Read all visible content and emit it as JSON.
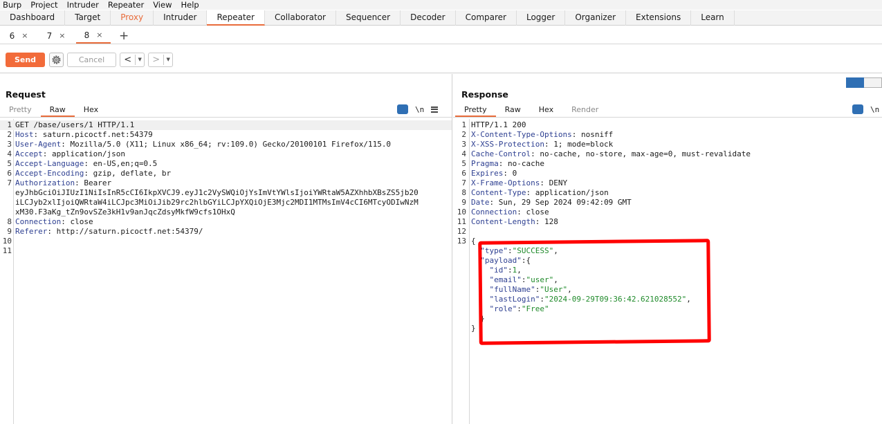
{
  "menubar": [
    "Burp",
    "Project",
    "Intruder",
    "Repeater",
    "View",
    "Help"
  ],
  "tool_tabs": [
    "Dashboard",
    "Target",
    "Proxy",
    "Intruder",
    "Repeater",
    "Collaborator",
    "Sequencer",
    "Decoder",
    "Comparer",
    "Logger",
    "Organizer",
    "Extensions",
    "Learn"
  ],
  "sub_tabs": [
    {
      "label": "6",
      "close": "×"
    },
    {
      "label": "7",
      "close": "×"
    },
    {
      "label": "8",
      "close": "×"
    }
  ],
  "sub_tab_add": "+",
  "toolbar": {
    "send": "Send",
    "cancel": "Cancel",
    "prev": "<",
    "next": ">",
    "dropdown": "▼"
  },
  "colors": {
    "accent": "#e86b3a",
    "send": "#f26b3a",
    "blue": "#2f6fb4",
    "annotation": "#ff0000"
  },
  "request": {
    "title": "Request",
    "view_tabs": [
      "Pretty",
      "Raw",
      "Hex"
    ],
    "newline_label": "\\n",
    "lines": [
      {
        "n": "1",
        "name": "",
        "value": "GET /base/users/1 HTTP/1.1"
      },
      {
        "n": "2",
        "name": "Host",
        "value": ": saturn.picoctf.net:54379"
      },
      {
        "n": "3",
        "name": "User-Agent",
        "value": ": Mozilla/5.0 (X11; Linux x86_64; rv:109.0) Gecko/20100101 Firefox/115.0"
      },
      {
        "n": "4",
        "name": "Accept",
        "value": ": application/json"
      },
      {
        "n": "5",
        "name": "Accept-Language",
        "value": ": en-US,en;q=0.5"
      },
      {
        "n": "6",
        "name": "Accept-Encoding",
        "value": ": gzip, deflate, br"
      },
      {
        "n": "7",
        "name": "Authorization",
        "value": ": Bearer"
      },
      {
        "n": "",
        "name": "",
        "value": "eyJhbGciOiJIUzI1NiIsInR5cCI6IkpXVCJ9.eyJ1c2VySWQiOjYsImVtYWlsIjoiYWRtaW5AZXhhbXBsZS5jb20"
      },
      {
        "n": "",
        "name": "",
        "value": "iLCJyb2xlIjoiQWRtaW4iLCJpc3MiOiJib29rc2hlbGYiLCJpYXQiOjE3Mjc2MDI1MTMsImV4cCI6MTcyODIwNzM"
      },
      {
        "n": "",
        "name": "",
        "value": "xM30.F3aKg_tZn9ovSZe3kH1v9anJqcZdsyMkfW9cfs1OHxQ"
      },
      {
        "n": "8",
        "name": "Connection",
        "value": ": close"
      },
      {
        "n": "9",
        "name": "Referer",
        "value": ": http://saturn.picoctf.net:54379/"
      },
      {
        "n": "10",
        "name": "",
        "value": ""
      },
      {
        "n": "11",
        "name": "",
        "value": ""
      }
    ]
  },
  "response": {
    "title": "Response",
    "view_tabs": [
      "Pretty",
      "Raw",
      "Hex",
      "Render"
    ],
    "newline_label": "\\n",
    "lines": [
      {
        "n": "1",
        "name": "",
        "value": "HTTP/1.1 200"
      },
      {
        "n": "2",
        "name": "X-Content-Type-Options",
        "value": ": nosniff"
      },
      {
        "n": "3",
        "name": "X-XSS-Protection",
        "value": ": 1; mode=block"
      },
      {
        "n": "4",
        "name": "Cache-Control",
        "value": ": no-cache, no-store, max-age=0, must-revalidate"
      },
      {
        "n": "5",
        "name": "Pragma",
        "value": ": no-cache"
      },
      {
        "n": "6",
        "name": "Expires",
        "value": ": 0"
      },
      {
        "n": "7",
        "name": "X-Frame-Options",
        "value": ": DENY"
      },
      {
        "n": "8",
        "name": "Content-Type",
        "value": ": application/json"
      },
      {
        "n": "9",
        "name": "Date",
        "value": ": Sun, 29 Sep 2024 09:42:09 GMT"
      },
      {
        "n": "10",
        "name": "Connection",
        "value": ": close"
      },
      {
        "n": "11",
        "name": "Content-Length",
        "value": ": 128"
      },
      {
        "n": "12",
        "name": "",
        "value": ""
      },
      {
        "n": "13",
        "name": "",
        "value": "{"
      }
    ],
    "json": [
      {
        "indent": "  ",
        "key": "\"type\"",
        "sep": ":",
        "val": "\"SUCCESS\"",
        "end": ","
      },
      {
        "indent": "  ",
        "key": "\"payload\"",
        "sep": ":",
        "val": "",
        "end": "{"
      },
      {
        "indent": "    ",
        "key": "\"id\"",
        "sep": ":",
        "val": "1",
        "end": ","
      },
      {
        "indent": "    ",
        "key": "\"email\"",
        "sep": ":",
        "val": "\"user\"",
        "end": ","
      },
      {
        "indent": "    ",
        "key": "\"fullName\"",
        "sep": ":",
        "val": "\"User\"",
        "end": ","
      },
      {
        "indent": "    ",
        "key": "\"lastLogin\"",
        "sep": ":",
        "val": "\"2024-09-29T09:36:42.621028552\"",
        "end": ","
      },
      {
        "indent": "    ",
        "key": "\"role\"",
        "sep": ":",
        "val": "\"Free\"",
        "end": ""
      },
      {
        "indent": "  ",
        "key": "",
        "sep": "",
        "val": "",
        "end": "}"
      },
      {
        "indent": "",
        "key": "",
        "sep": "",
        "val": "",
        "end": "}"
      }
    ]
  }
}
